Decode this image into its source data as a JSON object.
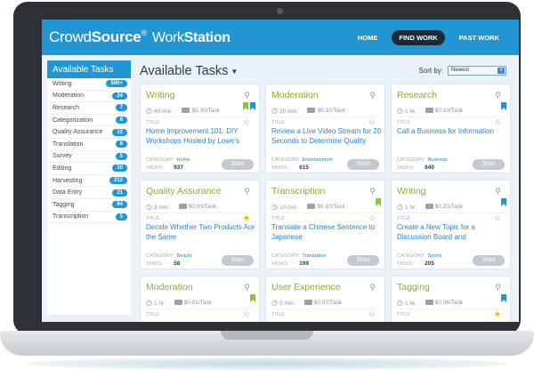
{
  "app": {
    "logo_crowd": "Crowd",
    "logo_source": "Source",
    "logo_reg": "®",
    "logo_work": "Work",
    "logo_station": "Station"
  },
  "nav": [
    "HOME",
    "FIND WORK",
    "PAST WORK"
  ],
  "sidebar": {
    "title": "Available Tasks",
    "items": [
      {
        "label": "Writing",
        "count": "500+"
      },
      {
        "label": "Moderation",
        "count": "24"
      },
      {
        "label": "Research",
        "count": "7"
      },
      {
        "label": "Categorization",
        "count": "8"
      },
      {
        "label": "Quality Assurance",
        "count": "12"
      },
      {
        "label": "Translation",
        "count": "8"
      },
      {
        "label": "Survey",
        "count": "5"
      },
      {
        "label": "Editing",
        "count": "10"
      },
      {
        "label": "Harvesting",
        "count": "212"
      },
      {
        "label": "Data Entry",
        "count": "21"
      },
      {
        "label": "Tagging",
        "count": "84"
      },
      {
        "label": "Transcription",
        "count": "5"
      }
    ]
  },
  "main": {
    "title": "Available Tasks",
    "caret": "▼",
    "sort_label": "Sort by:",
    "sort_value": "Newest",
    "title_label": "TITLE",
    "category_label": "CATEGORY:",
    "tasks_label": "TASKS:",
    "start_label": "Start"
  },
  "cards": [
    {
      "title": "Writing",
      "time": "40 min.",
      "pay": "$0.30/Task",
      "ribbons": [
        "green",
        "blue"
      ],
      "star": "empty",
      "task": "Home Improvement 101: DIY Workshops Hosted by Lowe's",
      "category": "Home",
      "tasks": "937"
    },
    {
      "title": "Moderation",
      "time": "20 min.",
      "pay": "$0.10/Task",
      "ribbons": [],
      "star": "empty",
      "task": "Review a Live Video Stream for 20 Seconds to Determine Quality",
      "category": "Entertainment",
      "tasks": "615"
    },
    {
      "title": "Research",
      "time": "1 hr.",
      "pay": "$0.10/Task",
      "ribbons": [
        "blue"
      ],
      "star": "empty",
      "task": "Call a Business for Information",
      "category": "Business",
      "tasks": "840"
    },
    {
      "title": "Quality Assurance",
      "time": "3 min.",
      "pay": "$0.05/Task",
      "ribbons": [],
      "star": "gold",
      "task": "Decide Whether Two Products Are the Same",
      "category": "Beauty",
      "tasks": "58"
    },
    {
      "title": "Transcription",
      "time": "10 min.",
      "pay": "$0.10/Task",
      "ribbons": [
        "green"
      ],
      "star": "empty",
      "task": "Translate a Chinese Sentence to Japanese",
      "category": "Translation",
      "tasks": "199"
    },
    {
      "title": "Writing",
      "time": "1 hr.",
      "pay": "$0.20/Task",
      "ribbons": [
        "blue"
      ],
      "star": "empty",
      "task": "Create a New Topic for a Discussion Board and",
      "category": "Sports",
      "tasks": "205"
    },
    {
      "title": "Moderation",
      "time": "1 hr.",
      "pay": "$0.01/Task",
      "ribbons": [
        "green"
      ],
      "star": "empty",
      "task": "",
      "category": "",
      "tasks": ""
    },
    {
      "title": "User Experience",
      "time": "5 min.",
      "pay": "$0.07/Task",
      "ribbons": [],
      "star": "empty",
      "task": "",
      "category": "",
      "tasks": ""
    },
    {
      "title": "Tagging",
      "time": "1 hr.",
      "pay": "$0.06/Task",
      "ribbons": [
        "blue"
      ],
      "star": "gold",
      "task": "",
      "category": "",
      "tasks": ""
    }
  ],
  "colors": {
    "brand_blue": "#2196d3",
    "title_green": "#8ab31e",
    "link_blue": "#2a84c6",
    "star_gold": "#f5b400"
  }
}
